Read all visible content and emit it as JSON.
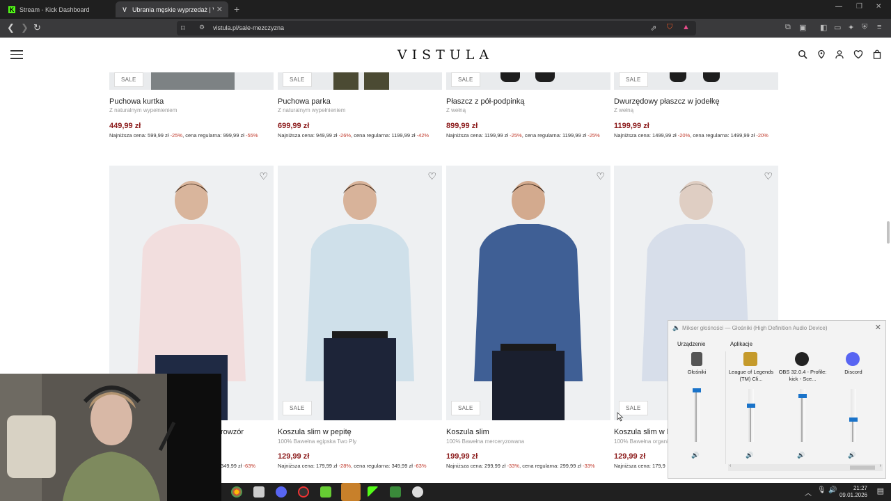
{
  "browser": {
    "tabs": [
      {
        "title": "Stream - Kick Dashboard",
        "active": false
      },
      {
        "title": "Ubrania męskie wyprzedaż | Vist",
        "active": true
      }
    ],
    "url": "vistula.pl/sale-mezczyzna"
  },
  "site": {
    "logo": "VISTULA",
    "header_icons": [
      "search-icon",
      "location-pin-icon",
      "user-icon",
      "heart-icon",
      "bag-icon"
    ]
  },
  "products_top": [
    {
      "badge": "SALE",
      "name": "Puchowa kurtka",
      "desc": "Z naturalnym wypełnieniem",
      "price": "449,99 zł",
      "note_a": "Najniższa cena: 599,99 zł ",
      "pct_a": "-25%",
      "note_b": ", cena regularna: 999,99 zł ",
      "pct_b": "-55%"
    },
    {
      "badge": "SALE",
      "name": "Puchowa parka",
      "desc": "Z naturalnym wypełnieniem",
      "price": "699,99 zł",
      "note_a": "Najniższa cena: 949,99 zł ",
      "pct_a": "-26%",
      "note_b": ", cena regularna: 1199,99 zł ",
      "pct_b": "-42%"
    },
    {
      "badge": "SALE",
      "name": "Płaszcz z pół-podpinką",
      "desc": "Z wełną",
      "price": "899,99 zł",
      "note_a": "Najniższa cena: 1199,99 zł ",
      "pct_a": "-25%",
      "note_b": ", cena regularna: 1199,99 zł ",
      "pct_b": "-25%"
    },
    {
      "badge": "SALE",
      "name": "Dwurzędowy płaszcz w jodełkę",
      "desc": "Z wełną",
      "price": "1199,99 zł",
      "note_a": "Najniższa cena: 1499,99 zł ",
      "pct_a": "-20%",
      "note_b": ", cena regularna: 1499,99 zł ",
      "pct_b": "-20%"
    }
  ],
  "products_bottom": [
    {
      "badge": "",
      "name": "rowzór",
      "desc": "",
      "price": "",
      "note_a": "349,99 zł ",
      "pct_a": "-63%",
      "note_b": "",
      "pct_b": "",
      "shirt": "#f2dede"
    },
    {
      "badge": "SALE",
      "name": "Koszula slim w pepitę",
      "desc": "100% Bawełna egipska Two Ply",
      "price": "129,99 zł",
      "note_a": "Najniższa cena: 179,99 zł ",
      "pct_a": "-28%",
      "note_b": ", cena regularna: 349,99 zł ",
      "pct_b": "-63%",
      "shirt": "#cfe0ea"
    },
    {
      "badge": "SALE",
      "name": "Koszula slim",
      "desc": "100% Bawełna merceryzowana",
      "price": "199,99 zł",
      "note_a": "Najniższa cena: 299,99 zł ",
      "pct_a": "-33%",
      "note_b": ", cena regularna: 299,99 zł ",
      "pct_b": "-33%",
      "shirt": "#3f5f95"
    },
    {
      "badge": "SALE",
      "name": "Koszula slim w k",
      "desc": "100% Bawełna organi",
      "price": "129,99 zł",
      "note_a": "Najniższa cena: 179,9",
      "pct_a": "",
      "note_b": "",
      "pct_b": "",
      "shirt": "#c8d3e6"
    }
  ],
  "mixer": {
    "title": "Mikser głośności — Głośniki (High Definition Audio Device)",
    "device_section": "Urządzenie",
    "apps_section": "Aplikacje",
    "columns": [
      {
        "label": "Głośniki",
        "level": 0.98,
        "color": "#555555"
      },
      {
        "label": "League of Legends (TM) Cli...",
        "level": 0.68,
        "color": "#c59a2b"
      },
      {
        "label": "OBS 32.0.4 - Profile: kick - Sce...",
        "level": 0.87,
        "color": "#222222"
      },
      {
        "label": "Discord",
        "level": 0.42,
        "color": "#5865f2"
      }
    ]
  },
  "taskbar": {
    "time": "21:27",
    "date": "09.01.2026"
  }
}
